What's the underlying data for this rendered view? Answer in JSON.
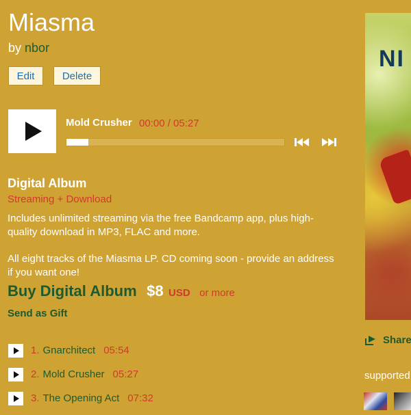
{
  "album": {
    "title": "Miasma",
    "by_prefix": "by",
    "artist": "nbor"
  },
  "admin": {
    "edit_label": "Edit",
    "delete_label": "Delete"
  },
  "player": {
    "track_title": "Mold Crusher",
    "time": "00:00 / 05:27",
    "progress": 0.1,
    "icons": {
      "play": "play-icon",
      "prev": "previous-track-icon",
      "next": "next-track-icon"
    }
  },
  "package": {
    "title": "Digital Album",
    "subtitle": "Streaming + Download",
    "description": "Includes unlimited streaming via the free Bandcamp app, plus high-quality download in MP3, FLAC and more.",
    "note": "All eight tracks of the Miasma LP. CD coming soon - provide an address if you want one!",
    "buy_label": "Buy Digital Album",
    "price": "$8",
    "currency": "USD",
    "or_more": "or more",
    "gift_label": "Send as Gift"
  },
  "tracks": [
    {
      "num": "1.",
      "name": "Gnarchitect",
      "duration": "05:54"
    },
    {
      "num": "2.",
      "name": "Mold Crusher",
      "duration": "05:27"
    },
    {
      "num": "3.",
      "name": "The Opening Act",
      "duration": "07:32"
    }
  ],
  "sidebar": {
    "art_text": "NI",
    "share_label": "Share",
    "supported_label": "supported"
  },
  "colors": {
    "background": "#cfa234",
    "link_green": "#1f5a2e",
    "accent_red": "#cf3b2b",
    "button_blue": "#1c6fb0"
  }
}
